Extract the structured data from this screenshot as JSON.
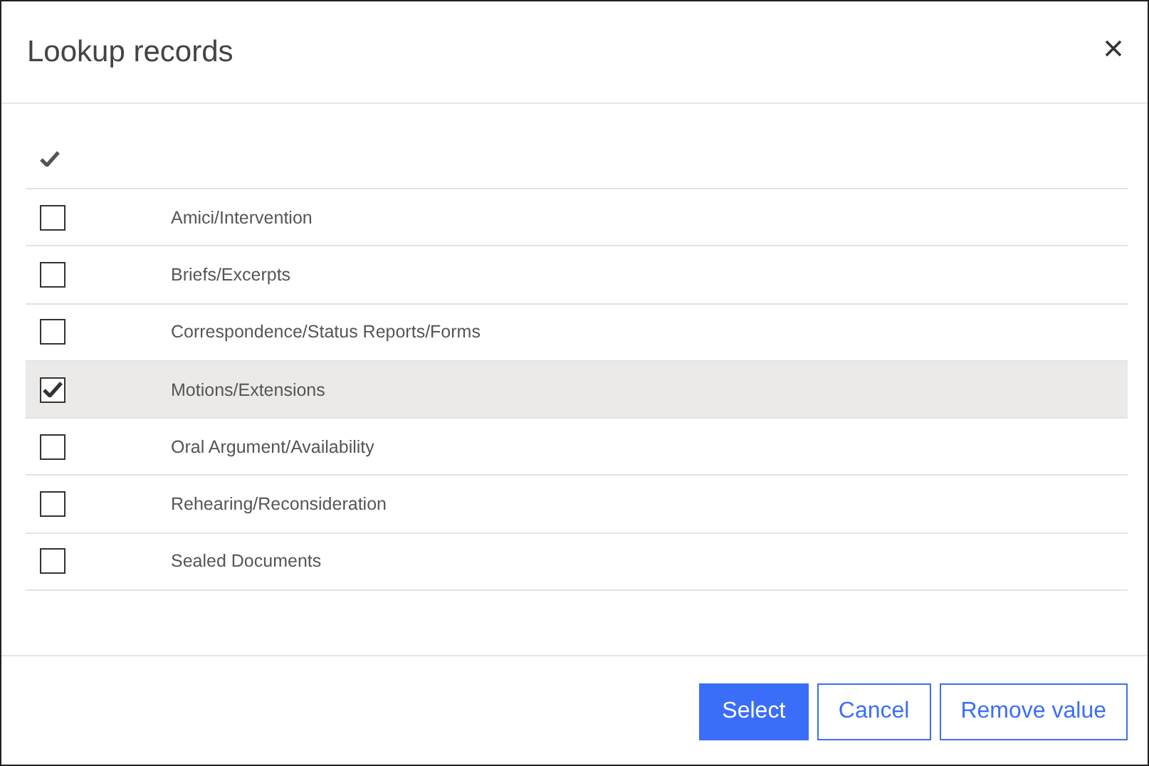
{
  "dialog": {
    "title": "Lookup records"
  },
  "records": [
    {
      "name": "Amici/Intervention",
      "selected": false
    },
    {
      "name": "Briefs/Excerpts",
      "selected": false
    },
    {
      "name": "Correspondence/Status Reports/Forms",
      "selected": false
    },
    {
      "name": "Motions/Extensions",
      "selected": true
    },
    {
      "name": "Oral Argument/Availability",
      "selected": false
    },
    {
      "name": "Rehearing/Reconsideration",
      "selected": false
    },
    {
      "name": "Sealed Documents",
      "selected": false
    }
  ],
  "buttons": [
    {
      "label": "Select",
      "kind": "primary"
    },
    {
      "label": "Cancel",
      "kind": "secondary"
    },
    {
      "label": "Remove value",
      "kind": "secondary"
    }
  ]
}
